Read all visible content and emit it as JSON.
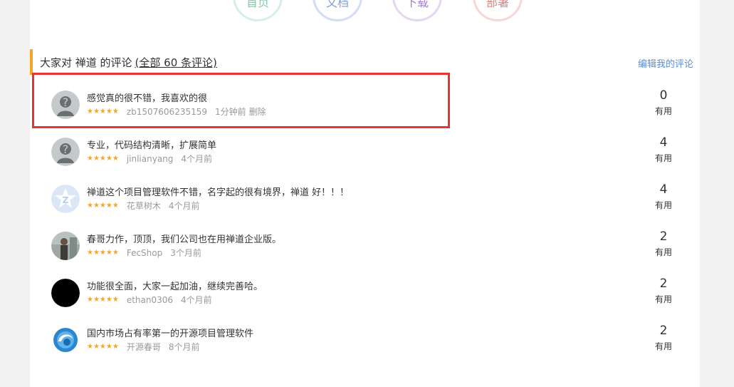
{
  "nav": {
    "home": "首页",
    "docs": "文档",
    "download": "下载",
    "deploy": "部署"
  },
  "section": {
    "title_prefix": "大家对 禅道 的评论",
    "count_link": "(全部 60 条评论)",
    "edit_link": "编辑我的评论"
  },
  "reviews": [
    {
      "text": "感觉真的很不错，我喜欢的很",
      "stars": "★★★★★",
      "author": "zb1507606235159",
      "time": "1分钟前",
      "delete": "删除",
      "helpful": "0",
      "helpful_label": "有用",
      "avatar": "default-user-icon"
    },
    {
      "text": "专业，代码结构清晰，扩展简单",
      "stars": "★★★★★",
      "author": "jinlianyang",
      "time": "4个月前",
      "helpful": "4",
      "helpful_label": "有用",
      "avatar": "default-user-icon"
    },
    {
      "text": "禅道这个项目管理软件不错，名字起的很有境界，禅道 好！！！",
      "stars": "★★★★★",
      "author": "花草树木",
      "time": "4个月前",
      "helpful": "4",
      "helpful_label": "有用",
      "avatar": "zentao-logo-icon"
    },
    {
      "text": "春哥力作，顶顶，我们公司也在用禅道企业版。",
      "stars": "★★★★★",
      "author": "FecShop",
      "time": "3个月前",
      "helpful": "2",
      "helpful_label": "有用",
      "avatar": "photo-avatar"
    },
    {
      "text": "功能很全面，大家一起加油，继续完善哈。",
      "stars": "★★★★★",
      "author": "ethan0306",
      "time": "4个月前",
      "helpful": "2",
      "helpful_label": "有用",
      "avatar": "black-circle-avatar"
    },
    {
      "text": "国内市场占有率第一的开源项目管理软件",
      "stars": "★★★★★",
      "author": "开源春哥",
      "time": "8个月前",
      "helpful": "2",
      "helpful_label": "有用",
      "avatar": "blue-swirl-logo-icon"
    }
  ]
}
